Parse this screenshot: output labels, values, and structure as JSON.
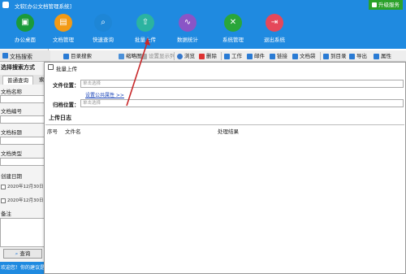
{
  "titlebar": {
    "title": "文软[办公文档管理系统]",
    "upgrade": "升级服务"
  },
  "toolbar": {
    "items": [
      {
        "label": "办公桌面",
        "glyph": "▣",
        "color": "#1b9a3a"
      },
      {
        "label": "文档管理",
        "glyph": "▤",
        "color": "#f29a15"
      },
      {
        "label": "快速查询",
        "glyph": "⌕",
        "color": "#1e86d6"
      },
      {
        "label": "批量上传",
        "glyph": "⇧",
        "color": "#2bb3a0"
      },
      {
        "label": "数据统计",
        "glyph": "∿",
        "color": "#8a55c6"
      },
      {
        "label": "系统管理",
        "glyph": "✕",
        "color": "#2aa63a"
      },
      {
        "label": "退出系统",
        "glyph": "⇥",
        "color": "#e5485a"
      }
    ]
  },
  "left_tab": {
    "label": "文档搜索"
  },
  "functions": {
    "items": [
      {
        "label": "目录搜索",
        "color": "#2a7bd4"
      },
      {
        "label": "缩略图",
        "color": "#4a90d9"
      },
      {
        "label": "设置显示列",
        "color": "#888888"
      },
      {
        "label": "浏览",
        "color": "#3377cc"
      },
      {
        "label": "删除",
        "color": "#d33"
      },
      {
        "label": "工作",
        "color": "#2a7bd4"
      },
      {
        "label": "邮件",
        "color": "#2a7bd4"
      },
      {
        "label": "链接",
        "color": "#2a7bd4"
      },
      {
        "label": "文档袋",
        "color": "#2a7bd4"
      },
      {
        "label": "到目录",
        "color": "#2a7bd4"
      },
      {
        "label": "导出",
        "color": "#2a7bd4"
      },
      {
        "label": "属性",
        "color": "#2a7bd4"
      }
    ]
  },
  "search_panel": {
    "title": "选择搜索方式",
    "tab_active": "普通查询",
    "tab_other": "索",
    "fields": {
      "name": "文档名称",
      "number": "文档编号",
      "tag": "文档标题",
      "type": "文档类型",
      "created": "创建日期",
      "date1": "2020年12月30日",
      "date2": "2020年12月30日",
      "remark": "备注"
    },
    "query_button": "查询"
  },
  "statusbar": {
    "text": "欢迎您！你的建议是"
  },
  "dialog": {
    "title": "批量上传",
    "file_location_label": "文件位置：",
    "file_location_placeholder": "单击选择",
    "settings_link": "设置公共属性 >>",
    "archive_location_label": "归档位置：",
    "archive_location_placeholder": "单击选择",
    "log_title": "上传日志",
    "columns": [
      "序号",
      "文件名",
      "处理结果"
    ]
  }
}
